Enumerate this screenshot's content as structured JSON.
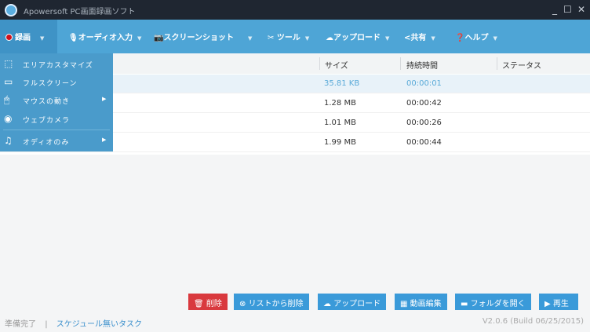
{
  "window": {
    "title": "Apowersoft PC画面録画ソフト",
    "minimize": "_",
    "maximize": "☐",
    "close": "✕"
  },
  "toolbar": {
    "items": [
      {
        "label": "録画",
        "icon": "record-icon"
      },
      {
        "label": "オーディオ入力",
        "icon": "microphone-icon"
      },
      {
        "label": "スクリーンショット",
        "icon": "camera-icon"
      },
      {
        "label": "ツール",
        "icon": "tools-icon"
      },
      {
        "label": "アップロード",
        "icon": "cloud-upload-icon"
      },
      {
        "label": "共有",
        "icon": "share-icon"
      },
      {
        "label": "ヘルプ",
        "icon": "help-icon"
      }
    ],
    "caret": "▼"
  },
  "record_menu": {
    "items": [
      {
        "label": "エリアカスタマイズ",
        "icon": "region-icon"
      },
      {
        "label": "フルスクリーン",
        "icon": "monitor-icon"
      },
      {
        "label": "マウスの動き",
        "icon": "mouse-icon",
        "submenu": true
      },
      {
        "label": "ウェブカメラ",
        "icon": "webcam-icon"
      },
      {
        "label": "オディオのみ",
        "icon": "music-icon",
        "submenu": true
      }
    ],
    "arrow": "▶"
  },
  "table": {
    "columns": [
      "サイズ",
      "持続時間",
      "ステータス"
    ],
    "rows": [
      {
        "size": "35.81 KB",
        "duration": "00:00:01",
        "status": "",
        "selected": true
      },
      {
        "size": "1.28 MB",
        "duration": "00:00:42",
        "status": ""
      },
      {
        "size": "1.01 MB",
        "duration": "00:00:26",
        "status": ""
      },
      {
        "size": "1.99 MB",
        "duration": "00:00:44",
        "status": ""
      }
    ]
  },
  "actions": {
    "delete": "削除",
    "remove_from_list": "リストから削除",
    "upload": "アップロード",
    "edit_video": "動画編集",
    "open_folder": "フォルダを開く",
    "play": "再生"
  },
  "status": {
    "ready": "準備完了",
    "separator": "|",
    "schedule": "スケジュール無いタスク",
    "version": "V2.0.6 (Build 06/25/2015)"
  },
  "colors": {
    "toolbar": "#4ea5d6",
    "titlebar": "#1f2631",
    "delete": "#d9393e",
    "button": "#3a9ad9"
  }
}
